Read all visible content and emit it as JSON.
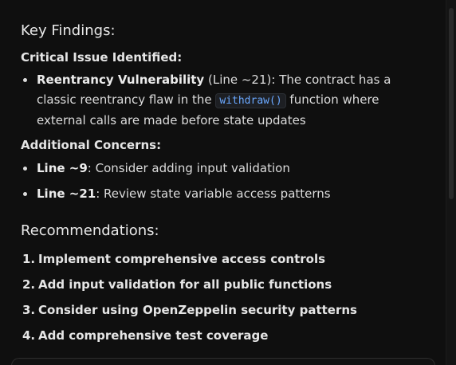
{
  "key_findings": {
    "title": "Key Findings:",
    "critical_heading": "Critical Issue Identified:",
    "critical_item": {
      "label": "Reentrancy Vulnerability",
      "paren": " (Line ~21)",
      "text_before_code": ": The contract has a classic reentrancy flaw in the ",
      "code": "withdraw()",
      "text_after_code": " function where external calls are made before state updates"
    },
    "additional_heading": "Additional Concerns:",
    "additional_items": [
      {
        "label": "Line ~9",
        "text": ": Consider adding input validation"
      },
      {
        "label": "Line ~21",
        "text": ": Review state variable access patterns"
      }
    ]
  },
  "recommendations": {
    "title": "Recommendations:",
    "items": [
      {
        "num": "1.",
        "text": "Implement comprehensive access controls"
      },
      {
        "num": "2.",
        "text": "Add input validation for all public functions"
      },
      {
        "num": "3.",
        "text": "Consider using OpenZeppelin security patterns"
      },
      {
        "num": "4.",
        "text": "Add comprehensive test coverage"
      }
    ]
  },
  "colors": {
    "background": "#0f0f0f",
    "text": "#dcdcdc",
    "code_accent": "#6aa8ff"
  }
}
